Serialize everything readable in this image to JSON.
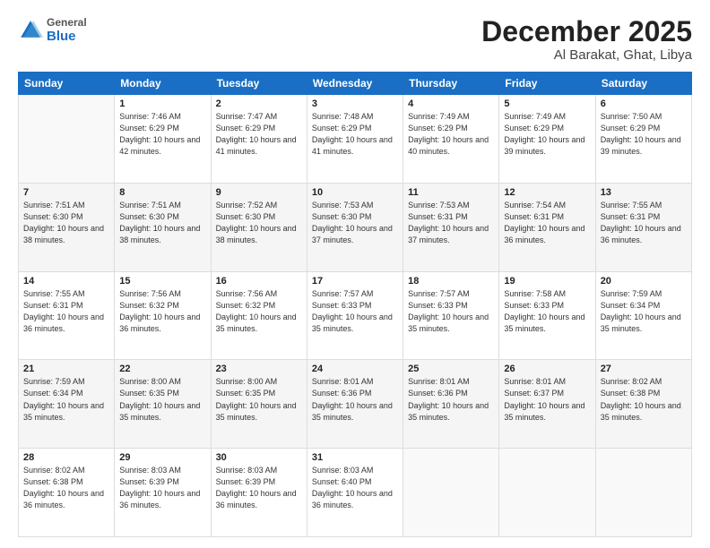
{
  "logo": {
    "general": "General",
    "blue": "Blue"
  },
  "header": {
    "title": "December 2025",
    "subtitle": "Al Barakat, Ghat, Libya"
  },
  "weekdays": [
    "Sunday",
    "Monday",
    "Tuesday",
    "Wednesday",
    "Thursday",
    "Friday",
    "Saturday"
  ],
  "weeks": [
    [
      {
        "day": "",
        "info": ""
      },
      {
        "day": "1",
        "info": "Sunrise: 7:46 AM\nSunset: 6:29 PM\nDaylight: 10 hours and 42 minutes."
      },
      {
        "day": "2",
        "info": "Sunrise: 7:47 AM\nSunset: 6:29 PM\nDaylight: 10 hours and 41 minutes."
      },
      {
        "day": "3",
        "info": "Sunrise: 7:48 AM\nSunset: 6:29 PM\nDaylight: 10 hours and 41 minutes."
      },
      {
        "day": "4",
        "info": "Sunrise: 7:49 AM\nSunset: 6:29 PM\nDaylight: 10 hours and 40 minutes."
      },
      {
        "day": "5",
        "info": "Sunrise: 7:49 AM\nSunset: 6:29 PM\nDaylight: 10 hours and 39 minutes."
      },
      {
        "day": "6",
        "info": "Sunrise: 7:50 AM\nSunset: 6:29 PM\nDaylight: 10 hours and 39 minutes."
      }
    ],
    [
      {
        "day": "7",
        "info": "Sunrise: 7:51 AM\nSunset: 6:30 PM\nDaylight: 10 hours and 38 minutes."
      },
      {
        "day": "8",
        "info": "Sunrise: 7:51 AM\nSunset: 6:30 PM\nDaylight: 10 hours and 38 minutes."
      },
      {
        "day": "9",
        "info": "Sunrise: 7:52 AM\nSunset: 6:30 PM\nDaylight: 10 hours and 38 minutes."
      },
      {
        "day": "10",
        "info": "Sunrise: 7:53 AM\nSunset: 6:30 PM\nDaylight: 10 hours and 37 minutes."
      },
      {
        "day": "11",
        "info": "Sunrise: 7:53 AM\nSunset: 6:31 PM\nDaylight: 10 hours and 37 minutes."
      },
      {
        "day": "12",
        "info": "Sunrise: 7:54 AM\nSunset: 6:31 PM\nDaylight: 10 hours and 36 minutes."
      },
      {
        "day": "13",
        "info": "Sunrise: 7:55 AM\nSunset: 6:31 PM\nDaylight: 10 hours and 36 minutes."
      }
    ],
    [
      {
        "day": "14",
        "info": "Sunrise: 7:55 AM\nSunset: 6:31 PM\nDaylight: 10 hours and 36 minutes."
      },
      {
        "day": "15",
        "info": "Sunrise: 7:56 AM\nSunset: 6:32 PM\nDaylight: 10 hours and 36 minutes."
      },
      {
        "day": "16",
        "info": "Sunrise: 7:56 AM\nSunset: 6:32 PM\nDaylight: 10 hours and 35 minutes."
      },
      {
        "day": "17",
        "info": "Sunrise: 7:57 AM\nSunset: 6:33 PM\nDaylight: 10 hours and 35 minutes."
      },
      {
        "day": "18",
        "info": "Sunrise: 7:57 AM\nSunset: 6:33 PM\nDaylight: 10 hours and 35 minutes."
      },
      {
        "day": "19",
        "info": "Sunrise: 7:58 AM\nSunset: 6:33 PM\nDaylight: 10 hours and 35 minutes."
      },
      {
        "day": "20",
        "info": "Sunrise: 7:59 AM\nSunset: 6:34 PM\nDaylight: 10 hours and 35 minutes."
      }
    ],
    [
      {
        "day": "21",
        "info": "Sunrise: 7:59 AM\nSunset: 6:34 PM\nDaylight: 10 hours and 35 minutes."
      },
      {
        "day": "22",
        "info": "Sunrise: 8:00 AM\nSunset: 6:35 PM\nDaylight: 10 hours and 35 minutes."
      },
      {
        "day": "23",
        "info": "Sunrise: 8:00 AM\nSunset: 6:35 PM\nDaylight: 10 hours and 35 minutes."
      },
      {
        "day": "24",
        "info": "Sunrise: 8:01 AM\nSunset: 6:36 PM\nDaylight: 10 hours and 35 minutes."
      },
      {
        "day": "25",
        "info": "Sunrise: 8:01 AM\nSunset: 6:36 PM\nDaylight: 10 hours and 35 minutes."
      },
      {
        "day": "26",
        "info": "Sunrise: 8:01 AM\nSunset: 6:37 PM\nDaylight: 10 hours and 35 minutes."
      },
      {
        "day": "27",
        "info": "Sunrise: 8:02 AM\nSunset: 6:38 PM\nDaylight: 10 hours and 35 minutes."
      }
    ],
    [
      {
        "day": "28",
        "info": "Sunrise: 8:02 AM\nSunset: 6:38 PM\nDaylight: 10 hours and 36 minutes."
      },
      {
        "day": "29",
        "info": "Sunrise: 8:03 AM\nSunset: 6:39 PM\nDaylight: 10 hours and 36 minutes."
      },
      {
        "day": "30",
        "info": "Sunrise: 8:03 AM\nSunset: 6:39 PM\nDaylight: 10 hours and 36 minutes."
      },
      {
        "day": "31",
        "info": "Sunrise: 8:03 AM\nSunset: 6:40 PM\nDaylight: 10 hours and 36 minutes."
      },
      {
        "day": "",
        "info": ""
      },
      {
        "day": "",
        "info": ""
      },
      {
        "day": "",
        "info": ""
      }
    ]
  ]
}
